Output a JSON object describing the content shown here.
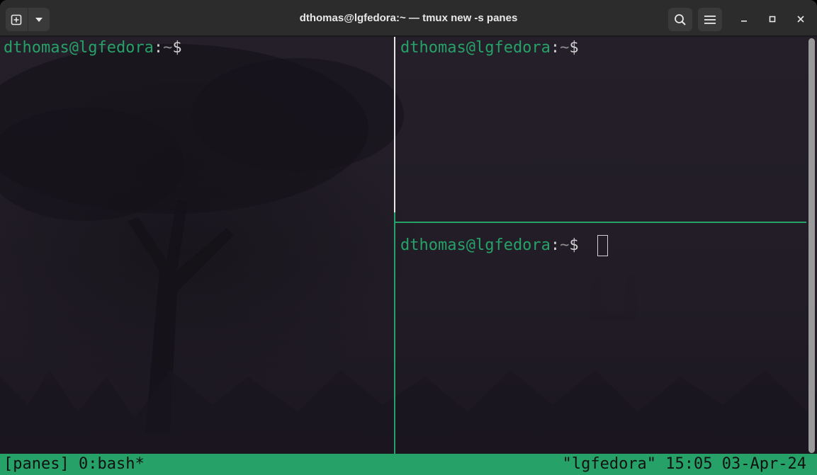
{
  "window": {
    "title": "dthomas@lgfedora:~ — tmux new -s panes"
  },
  "header": {
    "new_tab_icon": "new-tab-icon",
    "dropdown_icon": "chevron-down-icon",
    "search_icon": "search-icon",
    "menu_icon": "hamburger-menu-icon",
    "minimize_icon": "minimize-icon",
    "maximize_icon": "maximize-icon",
    "close_icon": "close-icon"
  },
  "panes": {
    "left": {
      "user_host": "dthomas@lgfedora",
      "colon": ":",
      "path": "~",
      "symbol": "$"
    },
    "top_right": {
      "user_host": "dthomas@lgfedora",
      "colon": ":",
      "path": "~",
      "symbol": "$"
    },
    "bottom_right": {
      "user_host": "dthomas@lgfedora",
      "colon": ":",
      "path": "~",
      "symbol": "$"
    }
  },
  "statusbar": {
    "session": "[panes]",
    "window": "0:bash*",
    "host": "\"lgfedora\"",
    "time": "15:05",
    "date": "03-Apr-24"
  },
  "colors": {
    "prompt": "#26a269",
    "status_bg": "#26a269",
    "active_border": "#26a269",
    "inactive_border": "#e8e8e8",
    "header_bg": "#2c2c2c"
  }
}
